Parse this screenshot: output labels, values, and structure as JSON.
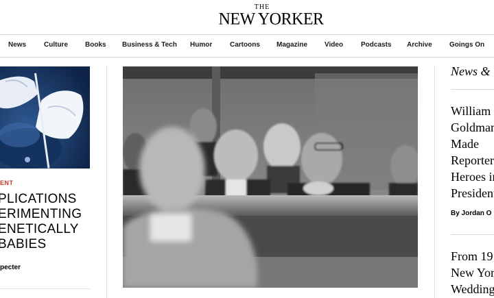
{
  "header": {
    "logo_the": "THE",
    "logo_main": "NEW YORKER"
  },
  "nav": {
    "items": [
      "News",
      "Culture",
      "Books",
      "Business & Tech",
      "Humor",
      "Cartoons",
      "Magazine",
      "Video",
      "Podcasts",
      "Archive",
      "Goings On"
    ]
  },
  "left_article": {
    "category": "ENT",
    "headline": "PLICATIONS\nERIMENTING\nENETICALLY\nBABIES",
    "byline": "pecter"
  },
  "right_rail": {
    "section_title": "News &",
    "headline": "William\nGoldman\nMade\nReporters\nHeroes in\nPresident",
    "byline": "By Jordan O",
    "headline_2": "From 19\nNew Yor\nWedding"
  },
  "colors": {
    "accent_category": "#c0392b",
    "divider": "#e3e3e3"
  }
}
